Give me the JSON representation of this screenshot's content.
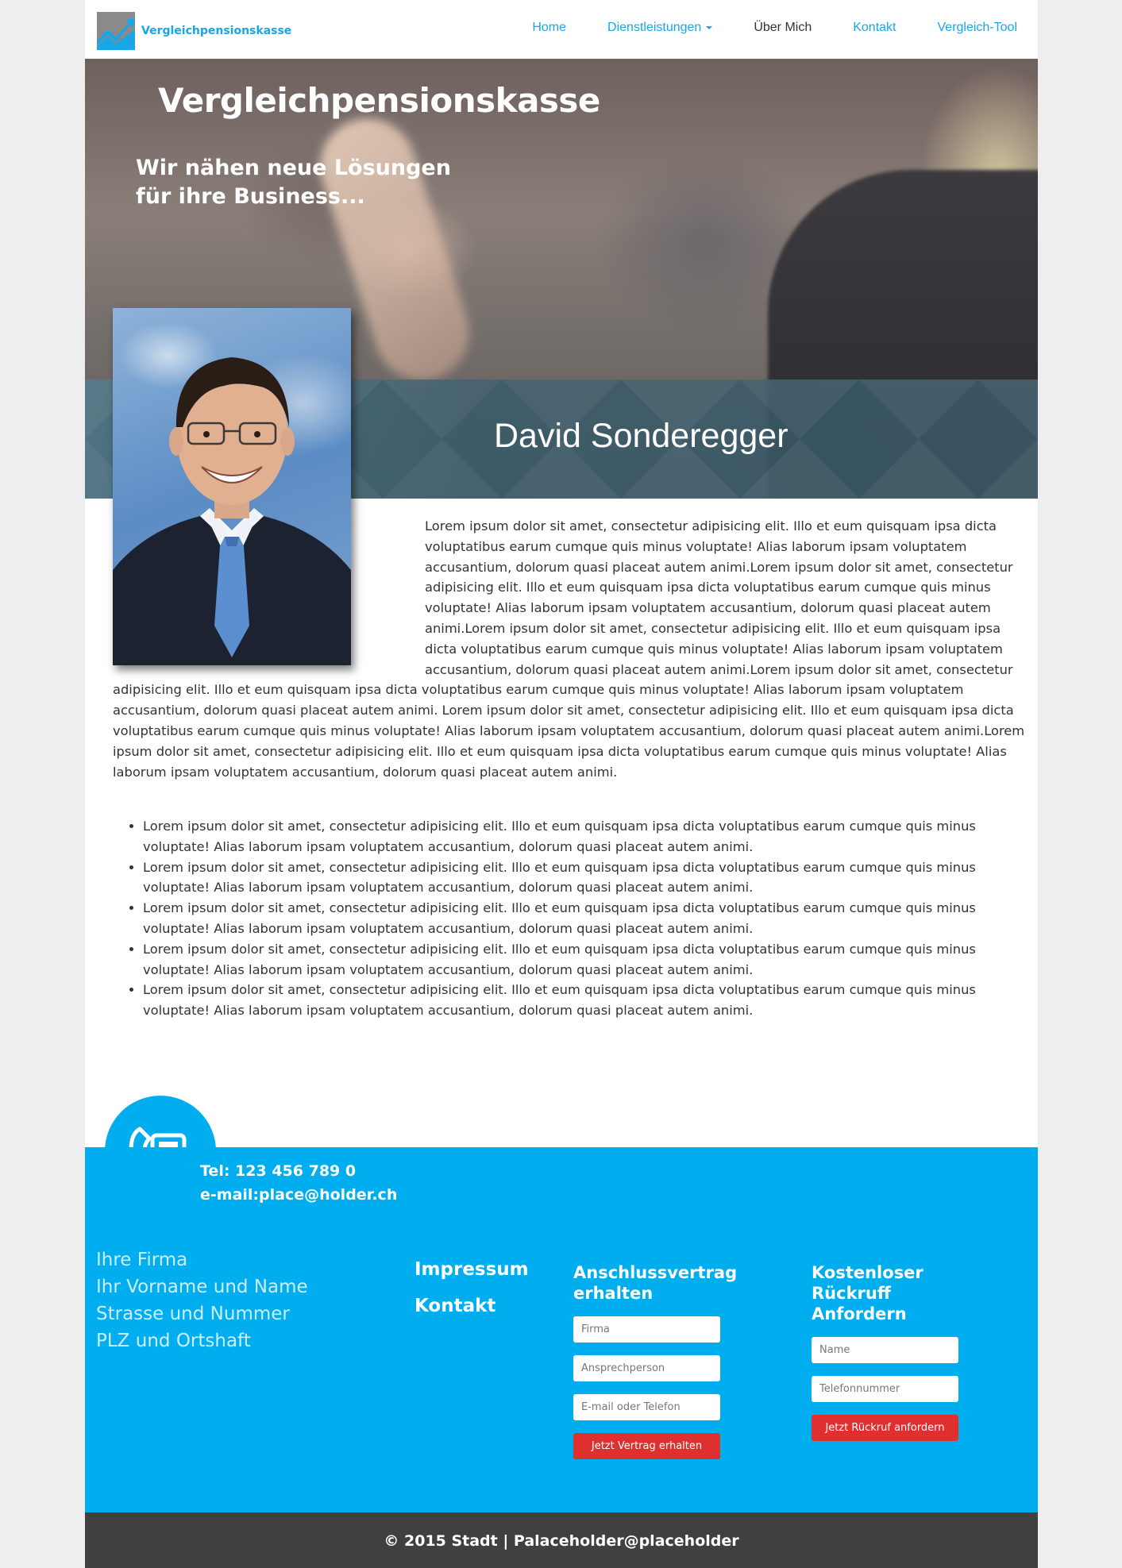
{
  "brand": {
    "name": "Vergleichpensionskasse"
  },
  "nav": {
    "items": [
      {
        "label": "Home",
        "active": false
      },
      {
        "label": "Dienstleistungen",
        "active": false,
        "dropdown": true
      },
      {
        "label": "Über Mich",
        "active": true
      },
      {
        "label": "Kontakt",
        "active": false
      },
      {
        "label": "Vergleich-Tool",
        "active": false
      }
    ]
  },
  "hero": {
    "title": "Vergleichpensionskasse",
    "subtitle_line1": "Wir nähen neue Lösungen",
    "subtitle_line2": "für ihre Business..."
  },
  "profile": {
    "name": "David Sonderegger",
    "bio": "Lorem ipsum dolor sit amet, consectetur adipisicing elit. Illo et eum quisquam ipsa dicta voluptatibus earum cumque quis minus voluptate! Alias laborum ipsam voluptatem accusantium, dolorum quasi placeat autem animi.Lorem ipsum dolor sit amet, consectetur adipisicing elit. Illo et eum quisquam ipsa dicta voluptatibus earum cumque quis minus voluptate! Alias laborum ipsam voluptatem accusantium, dolorum quasi placeat autem animi.Lorem ipsum dolor sit amet, consectetur adipisicing elit. Illo et eum quisquam ipsa dicta voluptatibus earum cumque quis minus voluptate! Alias laborum ipsam voluptatem accusantium, dolorum quasi placeat autem animi.Lorem ipsum dolor sit amet, consectetur adipisicing elit. Illo et eum quisquam ipsa dicta voluptatibus earum cumque quis minus voluptate! Alias laborum ipsam voluptatem accusantium, dolorum quasi placeat autem animi. Lorem ipsum dolor sit amet, consectetur adipisicing elit. Illo et eum quisquam ipsa dicta voluptatibus earum cumque quis minus voluptate! Alias laborum ipsam voluptatem accusantium, dolorum quasi placeat autem animi.Lorem ipsum dolor sit amet, consectetur adipisicing elit. Illo et eum quisquam ipsa dicta voluptatibus earum cumque quis minus voluptate! Alias laborum ipsam voluptatem accusantium, dolorum quasi placeat autem animi.",
    "bullets": [
      "Lorem ipsum dolor sit amet, consectetur adipisicing elit. Illo et eum quisquam ipsa dicta voluptatibus earum cumque quis minus voluptate! Alias laborum ipsam voluptatem accusantium, dolorum quasi placeat autem animi.",
      "Lorem ipsum dolor sit amet, consectetur adipisicing elit. Illo et eum quisquam ipsa dicta voluptatibus earum cumque quis minus voluptate! Alias laborum ipsam voluptatem accusantium, dolorum quasi placeat autem animi.",
      "Lorem ipsum dolor sit amet, consectetur adipisicing elit. Illo et eum quisquam ipsa dicta voluptatibus earum cumque quis minus voluptate! Alias laborum ipsam voluptatem accusantium, dolorum quasi placeat autem animi.",
      "Lorem ipsum dolor sit amet, consectetur adipisicing elit. Illo et eum quisquam ipsa dicta voluptatibus earum cumque quis minus voluptate! Alias laborum ipsam voluptatem accusantium, dolorum quasi placeat autem animi.",
      "Lorem ipsum dolor sit amet, consectetur adipisicing elit. Illo et eum quisquam ipsa dicta voluptatibus earum cumque quis minus voluptate! Alias laborum ipsam voluptatem accusantium, dolorum quasi placeat autem animi."
    ]
  },
  "footer": {
    "phone": "Tel: 123 456 789 0",
    "email": "e-mail:place@holder.ch",
    "address": [
      "Ihre Firma",
      "Ihr Vorname und Name",
      "Strasse und Nummer",
      "PLZ und Ortshaft"
    ],
    "links": [
      "Impressum",
      "Kontakt"
    ],
    "contract": {
      "title": "Anschlussvertrag erhalten",
      "placeholders": [
        "Firma",
        "Ansprechperson",
        "E-mail oder Telefon"
      ],
      "button": "Jetzt Vertrag erhalten"
    },
    "callback": {
      "title": "Kostenloser Rückruff Anfordern",
      "placeholders": [
        "Name",
        "Telefonnummer"
      ],
      "button": "Jetzt Rückruf anfordern"
    },
    "copyright": "© 2015 Stadt | Palaceholder@placeholder"
  },
  "icons": {
    "logo": "chart-logo-icon",
    "phone": "phone-icon"
  },
  "colors": {
    "accent": "#00aeef",
    "nav_link": "#1aa6e6",
    "cta": "#e02f2f",
    "bottom_bar": "#404040"
  }
}
